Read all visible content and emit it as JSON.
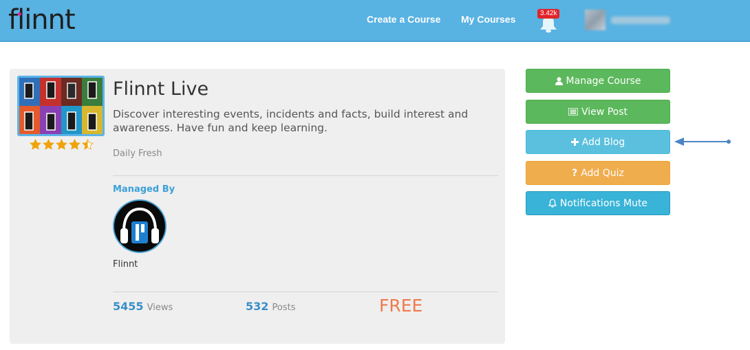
{
  "header": {
    "logo_text": "flinnt",
    "nav": [
      {
        "label": "Create a Course"
      },
      {
        "label": "My Courses"
      }
    ],
    "notification_count": "3.42k"
  },
  "course": {
    "title": "Flinnt Live",
    "description": "Discover interesting events, incidents and facts, build interest and awareness. Have fun and keep learning.",
    "category": "Daily Fresh",
    "rating": 4.5,
    "managed_by_label": "Managed By",
    "manager_name": "Flinnt",
    "views_count": "5455",
    "views_label": "Views",
    "posts_count": "532",
    "posts_label": "Posts",
    "price": "FREE"
  },
  "actions": [
    {
      "label": "Manage Course",
      "icon": "user-icon",
      "color": "#5cb85c"
    },
    {
      "label": "View Post",
      "icon": "list-icon",
      "color": "#5cb85c"
    },
    {
      "label": "Add Blog",
      "icon": "plus-icon",
      "color": "#5bc0de"
    },
    {
      "label": "Add Quiz",
      "icon": "question-icon",
      "color": "#f0ad4e"
    },
    {
      "label": "Notifications Mute",
      "icon": "bell-icon",
      "color": "#39b3d7"
    }
  ],
  "colors": {
    "header_bg": "#58b2e2",
    "link_blue": "#3aa0d8",
    "price_orange": "#ef7a4c",
    "star_gold": "#f0a30a"
  }
}
